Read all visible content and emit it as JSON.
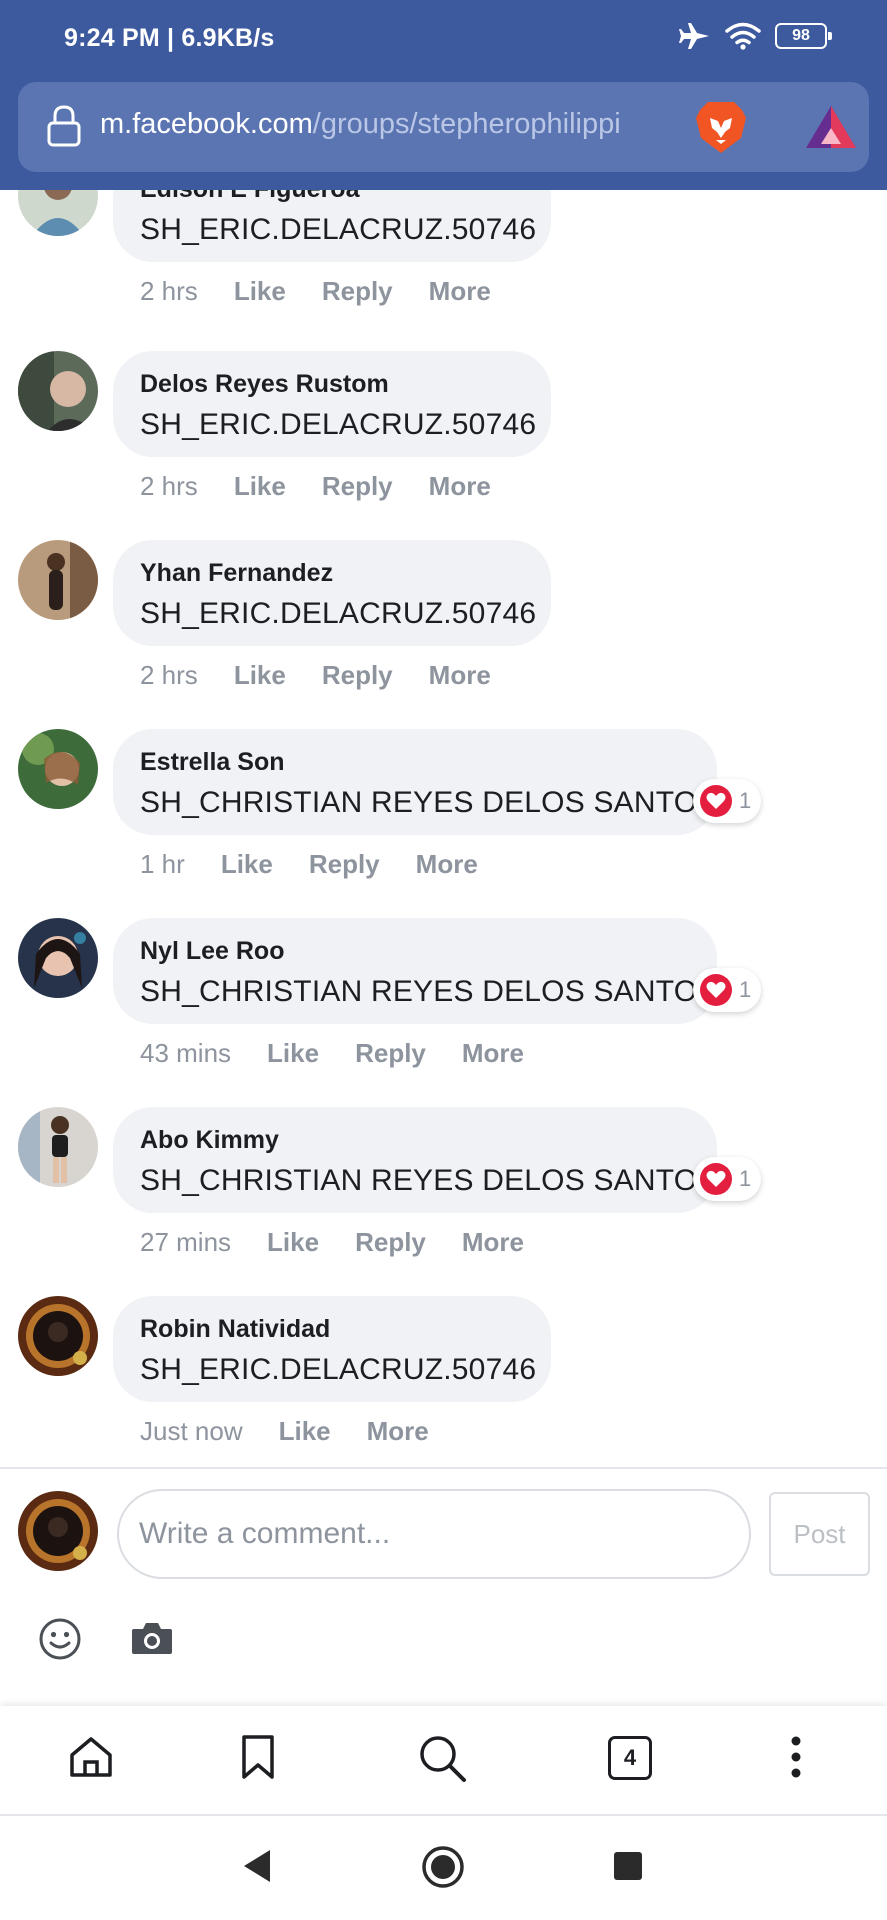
{
  "status_bar": {
    "time_speed": "9:24 PM | 6.9KB/s",
    "battery": "98"
  },
  "browser": {
    "url_domain": "m.facebook.com",
    "url_path": "/groups/stepherophilippi",
    "tab_count": "4"
  },
  "comments": [
    {
      "author": "Edison E Figueroa",
      "text": "SH_ERIC.DELACRUZ.50746",
      "time": "2 hrs",
      "like": "Like",
      "reply": "Reply",
      "more": "More"
    },
    {
      "author": "Delos Reyes Rustom",
      "text": "SH_ERIC.DELACRUZ.50746",
      "time": "2 hrs",
      "like": "Like",
      "reply": "Reply",
      "more": "More"
    },
    {
      "author": "Yhan Fernandez",
      "text": "SH_ERIC.DELACRUZ.50746",
      "time": "2 hrs",
      "like": "Like",
      "reply": "Reply",
      "more": "More"
    },
    {
      "author": "Estrella Son",
      "text": "SH_CHRISTIAN REYES DELOS SANTOS",
      "time": "1 hr",
      "like": "Like",
      "reply": "Reply",
      "more": "More",
      "reaction_count": "1"
    },
    {
      "author": "Nyl Lee Roo",
      "text": "SH_CHRISTIAN REYES DELOS SANTOS",
      "time": "43 mins",
      "like": "Like",
      "reply": "Reply",
      "more": "More",
      "reaction_count": "1"
    },
    {
      "author": "Abo Kimmy",
      "text": "SH_CHRISTIAN REYES DELOS SANTOS",
      "time": "27 mins",
      "like": "Like",
      "reply": "Reply",
      "more": "More",
      "reaction_count": "1"
    },
    {
      "author": "Robin Natividad",
      "text": "SH_ERIC.DELACRUZ.50746",
      "time": "Just now",
      "like": "Like",
      "more": "More"
    }
  ],
  "composer": {
    "placeholder": "Write a comment...",
    "post_label": "Post"
  },
  "colors": {
    "header_blue": "#3d5a9f",
    "bubble_gray": "#f0f2f5",
    "meta_gray": "#8d949e",
    "reaction_red": "#e41e3f"
  },
  "icons": {
    "status": [
      "airplane-icon",
      "wifi-icon",
      "battery-icon"
    ],
    "browser": [
      "lock-icon",
      "brave-lion-icon",
      "brave-rewards-icon"
    ],
    "composer": [
      "emoji-icon",
      "camera-icon"
    ],
    "toolbar": [
      "home-icon",
      "bookmark-icon",
      "search-icon",
      "tabs-icon",
      "more-vertical-icon"
    ],
    "system_nav": [
      "back-icon",
      "home-circle-icon",
      "recents-icon"
    ]
  }
}
